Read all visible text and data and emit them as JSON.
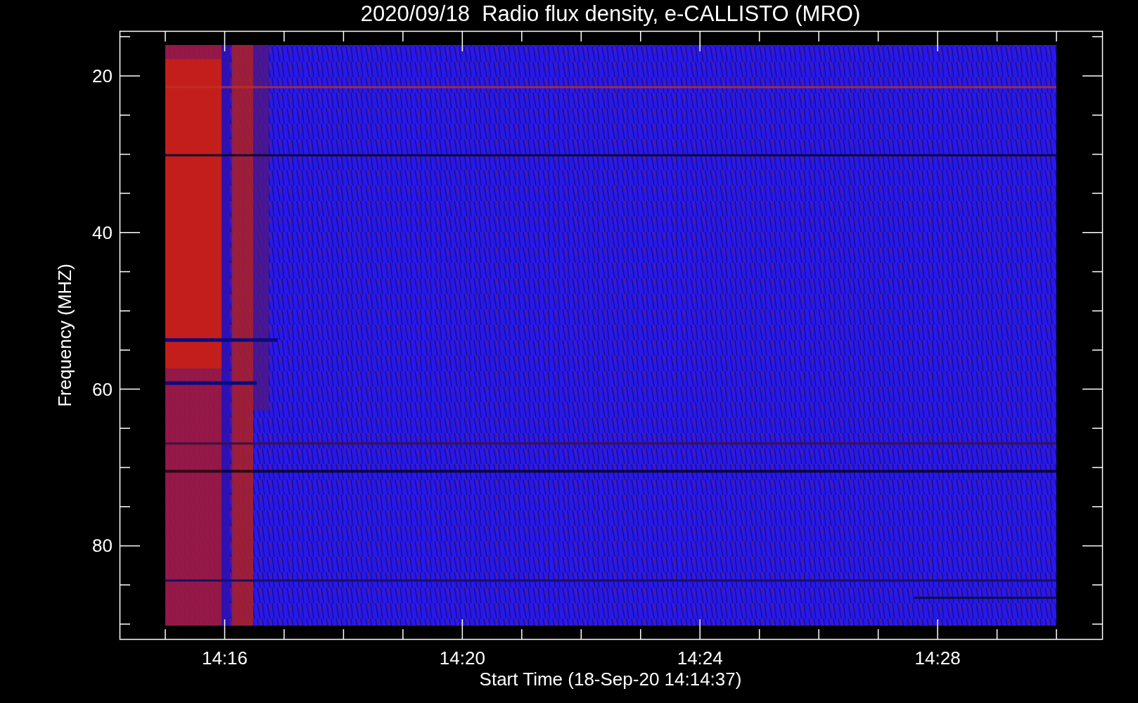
{
  "title": "2020/09/18  Radio flux density, e-CALLISTO (MRO)",
  "y_axis": {
    "label": "Frequency (MHZ)",
    "ticks": [
      "20",
      "40",
      "60",
      "80"
    ]
  },
  "x_axis": {
    "label": "Start Time (18-Sep-20 14:14:37)",
    "ticks": [
      "14:16",
      "14:20",
      "14:24",
      "14:28"
    ]
  }
}
